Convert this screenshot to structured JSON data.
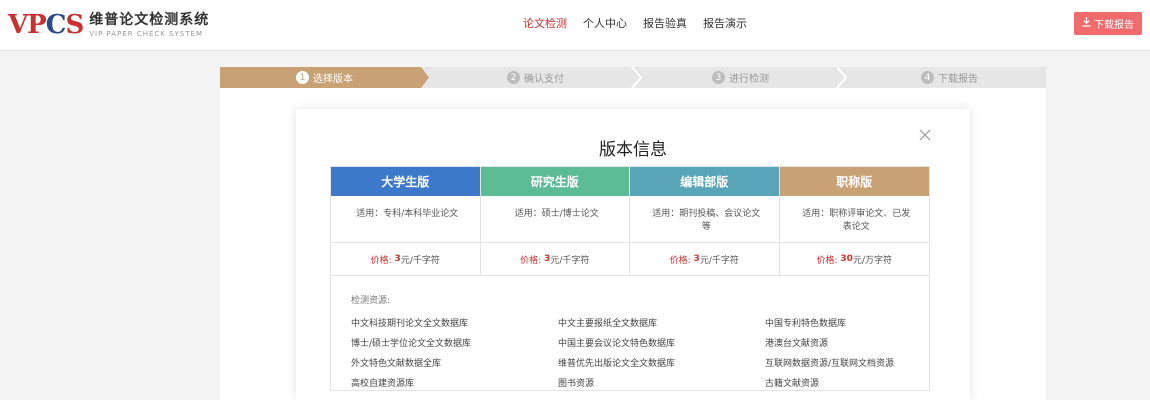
{
  "header": {
    "logo_mark_1": "VP",
    "logo_mark_2": "C",
    "logo_mark_3": "S",
    "logo_cn": "维普论文检测系统",
    "logo_en": "VIP PAPER CHECK SYSTEM",
    "nav": [
      "论文检测",
      "个人中心",
      "报告验真",
      "报告演示"
    ],
    "download_label": "下载报告"
  },
  "steps": [
    {
      "num": "1",
      "label": "选择版本"
    },
    {
      "num": "2",
      "label": "确认支付"
    },
    {
      "num": "3",
      "label": "进行检测"
    },
    {
      "num": "4",
      "label": "下载报告"
    }
  ],
  "card": {
    "title": "版本信息",
    "versions": [
      {
        "name": "大学生版",
        "color": "#3d79c9",
        "use": "适用：专科/本科毕业论文",
        "price_label": "价格:",
        "price_value": "3",
        "price_unit": "元/千字符"
      },
      {
        "name": "研究生版",
        "color": "#5bbc95",
        "use": "适用：硕士/博士论文",
        "price_label": "价格:",
        "price_value": "3",
        "price_unit": "元/千字符"
      },
      {
        "name": "编辑部版",
        "color": "#57a5b6",
        "use": "适用：期刊投稿、会议论文等",
        "price_label": "价格:",
        "price_value": "3",
        "price_unit": "元/千字符"
      },
      {
        "name": "职称版",
        "color": "#c8a175",
        "use": "适用：职称评审论文、已发表论文",
        "price_label": "价格:",
        "price_value": "30",
        "price_unit": "元/万字符"
      }
    ],
    "resources_title": "检测资源:",
    "resources": [
      "中文科技期刊论文全文数据库",
      "中文主要报纸全文数据库",
      "中国专利特色数据库",
      "博士/硕士学位论文全文数据库",
      "中国主要会议论文特色数据库",
      "港澳台文献资源",
      "外文特色文献数据全库",
      "维普优先出版论文全文数据库",
      "互联网数据资源/互联网文档资源",
      "高校自建资源库",
      "图书资源",
      "古籍文献资源"
    ]
  }
}
